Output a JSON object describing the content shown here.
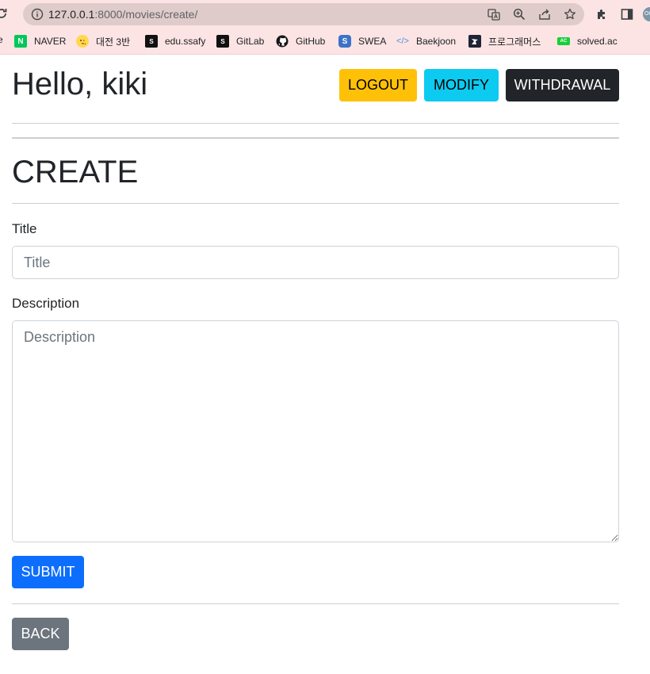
{
  "browser": {
    "url_host": "127.0.0.1",
    "url_path": ":8000/movies/create/",
    "profile_initials": "OC",
    "bookmarks_edge": "e",
    "bookmarks": [
      {
        "label": "NAVER",
        "icon": "naver-icon",
        "fav_text": "N",
        "color": "#03c75a"
      },
      {
        "label": "대전 3반",
        "icon": "emoji-icon",
        "fav_text": "😘",
        "color": "#ffd84d"
      },
      {
        "label": "edu.ssafy",
        "icon": "ssafy-icon",
        "fav_text": "S",
        "color": "#111111"
      },
      {
        "label": "GitLab",
        "icon": "ssafy-icon",
        "fav_text": "S",
        "color": "#111111"
      },
      {
        "label": "GitHub",
        "icon": "github-icon",
        "fav_text": "",
        "color": "#181717"
      },
      {
        "label": "SWEA",
        "icon": "swea-icon",
        "fav_text": "S",
        "color": "#3d72c8"
      },
      {
        "label": "Baekjoon",
        "icon": "code-icon",
        "fav_text": "</>",
        "color": "#4a8ed8"
      },
      {
        "label": "프로그래머스",
        "icon": "programmers-icon",
        "fav_text": "",
        "color": "#1e2435"
      },
      {
        "label": "solved.ac",
        "icon": "solvedac-icon",
        "fav_text": "AC",
        "color": "#17ce3a"
      }
    ]
  },
  "header": {
    "greeting": "Hello, kiki",
    "logout_label": "LOGOUT",
    "modify_label": "MODIFY",
    "withdrawal_label": "WITHDRAWAL"
  },
  "form": {
    "page_title": "CREATE",
    "title_label": "Title",
    "title_placeholder": "Title",
    "title_value": "",
    "description_label": "Description",
    "description_placeholder": "Description",
    "description_value": "",
    "submit_label": "SUBMIT"
  },
  "footer": {
    "back_label": "BACK"
  },
  "colors": {
    "warning": "#ffc107",
    "info": "#0dcaf0",
    "dark": "#212529",
    "primary": "#0d6efd",
    "secondary": "#6c757d",
    "chrome_bg": "#fce4e4"
  }
}
